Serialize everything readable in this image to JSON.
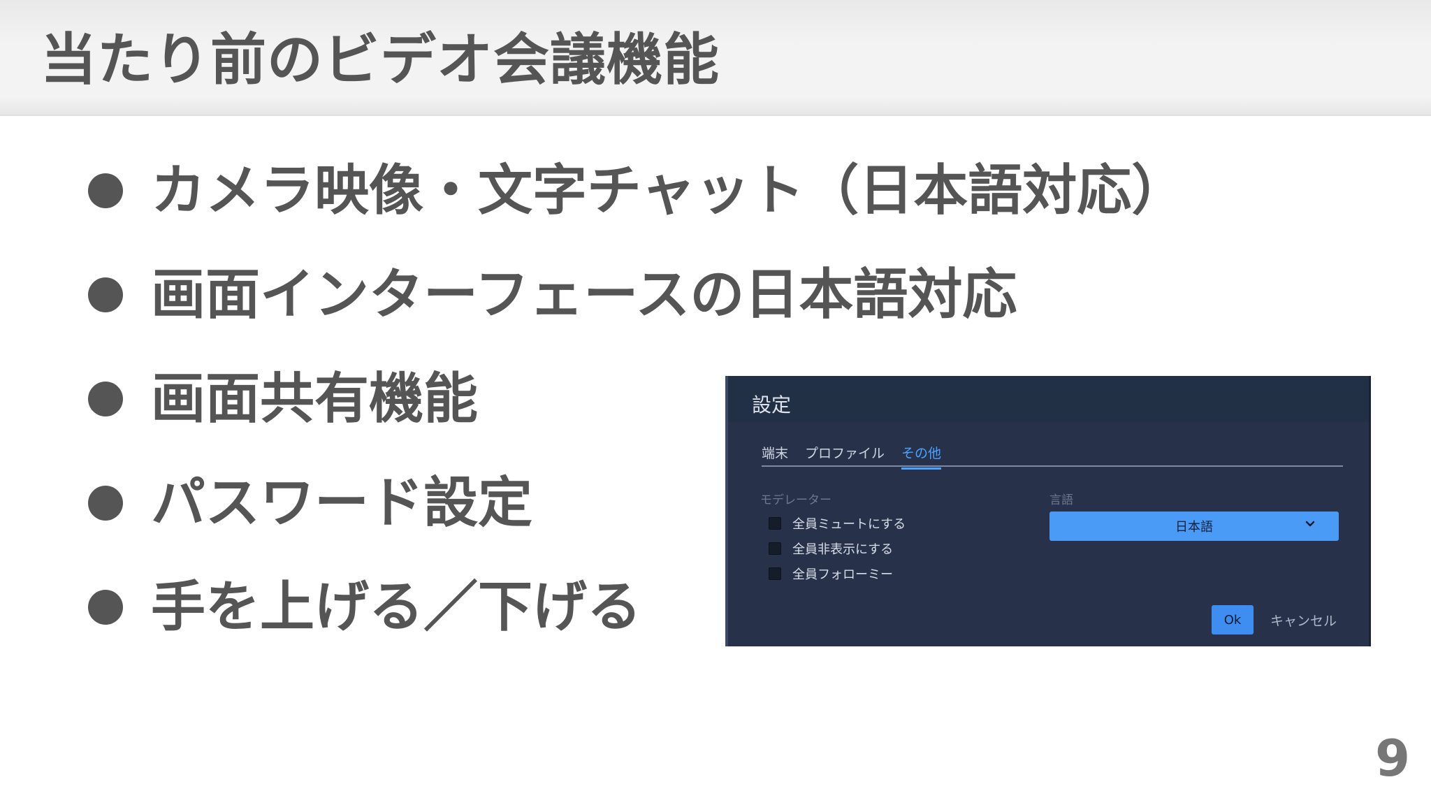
{
  "slide": {
    "title": "当たり前のビデオ会議機能",
    "page_number": "9"
  },
  "bullets": [
    {
      "text": "カメラ映像・文字チャット（日本語対応）"
    },
    {
      "text": "画面インターフェースの日本語対応"
    },
    {
      "text": "画面共有機能"
    },
    {
      "text": "パスワード設定"
    },
    {
      "text": "手を上げる／下げる"
    }
  ],
  "dialog": {
    "title": "設定",
    "tabs": [
      {
        "label": "端末",
        "active": false
      },
      {
        "label": "プロファイル",
        "active": false
      },
      {
        "label": "その他",
        "active": true
      }
    ],
    "moderator": {
      "label": "モデレーター",
      "options": [
        {
          "label": "全員ミュートにする",
          "checked": false
        },
        {
          "label": "全員非表示にする",
          "checked": false
        },
        {
          "label": "全員フォローミー",
          "checked": false
        }
      ]
    },
    "language": {
      "label": "言語",
      "selected": "日本語"
    },
    "ok_label": "Ok",
    "cancel_label": "キャンセル"
  },
  "colors": {
    "text_gray": "#555555",
    "dialog_bg": "#27324a",
    "accent_blue": "#4a9bf5"
  }
}
